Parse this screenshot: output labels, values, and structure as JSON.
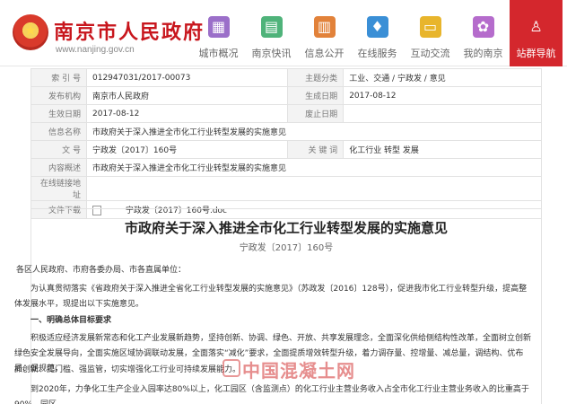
{
  "header": {
    "site_title": "南京市人民政府",
    "site_url": "www.nanjing.gov.cn"
  },
  "nav": [
    {
      "label": "城市概况",
      "icon": "building-icon",
      "color": "#9b6fc9"
    },
    {
      "label": "南京快讯",
      "icon": "newspaper-icon",
      "color": "#4fb37a"
    },
    {
      "label": "信息公开",
      "icon": "document-icon",
      "color": "#e2823a"
    },
    {
      "label": "在线服务",
      "icon": "thumbs-up-icon",
      "color": "#3a8fd6"
    },
    {
      "label": "互动交流",
      "icon": "chat-icon",
      "color": "#e8b52c"
    },
    {
      "label": "我的南京",
      "icon": "flower-icon",
      "color": "#b56ccc"
    },
    {
      "label": "站群导航",
      "icon": "user-icon",
      "color": "#d4272d"
    }
  ],
  "meta": {
    "index_label": "索 引 号",
    "index_value": "012947031/2017-00073",
    "category_label": "主题分类",
    "category_value": "工业、交通 / 宁政发 / 意见",
    "issuer_label": "发布机构",
    "issuer_value": "南京市人民政府",
    "generated_label": "生成日期",
    "generated_value": "2017-08-12",
    "created_label": "生效日期",
    "created_value": "2017-08-12",
    "expire_label": "废止日期",
    "expire_value": "",
    "name_label": "信息名称",
    "name_value": "市政府关于深入推进全市化工行业转型发展的实施意见",
    "docno_label": "文    号",
    "docno_value": "宁政发〔2017〕160号",
    "keywords_label": "关 键 词",
    "keywords_value": "化工行业 转型 发展",
    "summary_label": "内容概述",
    "summary_value": "市政府关于深入推进全市化工行业转型发展的实施意见",
    "online_label": "在线链接地址",
    "online_value": "",
    "attach_label": "文件下载",
    "attach_value": "宁政发〔2017〕160号.doc"
  },
  "article": {
    "title": "市政府关于深入推进全市化工行业转型发展的实施意见",
    "doc_no": "宁政发〔2017〕160号",
    "salutation": "各区人民政府、市府各委办局、市各直属单位：",
    "para1": "为认真贯彻落实《省政府关于深入推进全省化工行业转型发展的实施意见》（苏政发〔2016〕128号），促进我市化工行业转型升级，提高整体发展水平，现提出以下实施意见。",
    "heading1": "一、明确总体目标要求",
    "para2a": "积极适应经济发展新常态和化工产业发展新趋势，坚持创新、协调、绿色、开放、共享发展理念，全面深化供给侧结构性改革，全面树立创新绿色安全发展导向，全面实施区域协调联动发展，全面落实“减化”要求，全面提质增效转型升级，着力调存量、控增量、减总量，调结构、优布局、促规范，",
    "para2b": "抓创新、提门槛、强监管，切实增强化工行业可持续发展能力。",
    "para3": "到2020年，力争化工生产企业入园率达80%以上，化工园区（含监测点）的化工行业主营业务收入占全市化工行业主营业务收入的比重高于90%，园区"
  },
  "watermark": "中国混凝土网"
}
